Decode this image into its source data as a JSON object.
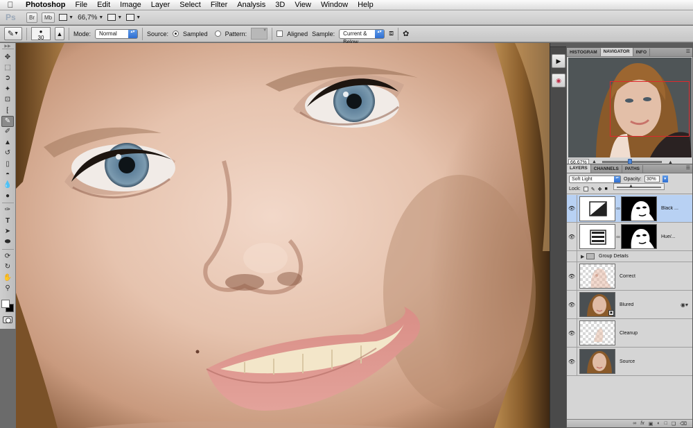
{
  "menubar": {
    "app_name": "Photoshop",
    "items": [
      "File",
      "Edit",
      "Image",
      "Layer",
      "Select",
      "Filter",
      "Analysis",
      "3D",
      "View",
      "Window",
      "Help"
    ]
  },
  "appbar": {
    "logo": "Ps",
    "bridge_label": "Br",
    "minibridge_label": "Mb",
    "zoom": "66,7%"
  },
  "options": {
    "brush_size": "30",
    "mode_label": "Mode:",
    "mode_value": "Normal",
    "source_label": "Source:",
    "sampled_label": "Sampled",
    "pattern_label": "Pattern:",
    "aligned_label": "Aligned",
    "sample_label": "Sample:",
    "sample_value": "Current & Below"
  },
  "navigator": {
    "tabs": [
      "HISTOGRAM",
      "NAVIGATOR",
      "INFO"
    ],
    "active_tab": "NAVIGATOR",
    "zoom": "66,67%",
    "view_box_color": "#e0282d"
  },
  "layers": {
    "tabs": [
      "LAYERS",
      "CHANNELS",
      "PATHS"
    ],
    "blend_mode": "Soft Light",
    "opacity_label": "Opacity:",
    "opacity_value": "30%",
    "lock_label": "Lock:",
    "items": [
      {
        "name": "Black ...",
        "kind": "adjustment",
        "selected": true
      },
      {
        "name": "Hue/...",
        "kind": "adjustment",
        "selected": false
      },
      {
        "name": "Group Details",
        "kind": "group",
        "selected": false
      },
      {
        "name": "Correct",
        "kind": "pixel",
        "selected": false
      },
      {
        "name": "Blured",
        "kind": "smart",
        "selected": false
      },
      {
        "name": "Cleanup",
        "kind": "pixel",
        "selected": false
      },
      {
        "name": "Source",
        "kind": "pixel",
        "selected": false
      }
    ],
    "footer_icons": [
      "link-icon",
      "fx-icon",
      "mask-icon",
      "adjustment-icon",
      "folder-icon",
      "new-layer-icon",
      "trash-icon"
    ]
  },
  "colors": {
    "foreground": "#ffffff",
    "background": "#000000",
    "selection_highlight": "#b8d1f3",
    "accent_blue": "#2f6fd2"
  }
}
